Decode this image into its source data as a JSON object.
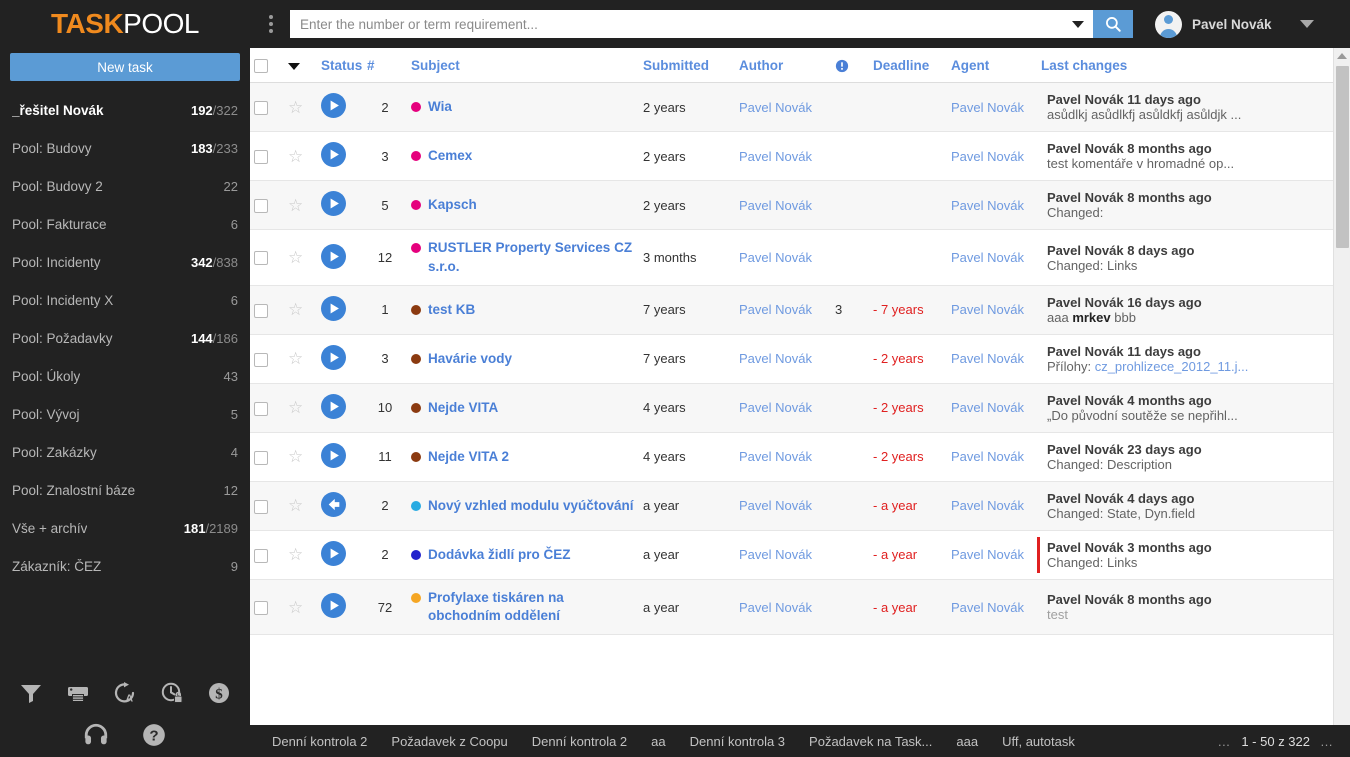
{
  "brand": {
    "part1": "TASK",
    "part2": "POOL"
  },
  "sidebar": {
    "new_task_label": "New task",
    "items": [
      {
        "label": "_řešitel Novák",
        "count_a": "192",
        "count_b": "322",
        "active": true
      },
      {
        "label": "Pool: Budovy",
        "count_a": "183",
        "count_b": "233",
        "active": false
      },
      {
        "label": "Pool: Budovy 2",
        "count_a": "",
        "count_b": "22",
        "active": false
      },
      {
        "label": "Pool: Fakturace",
        "count_a": "",
        "count_b": "6",
        "active": false
      },
      {
        "label": "Pool: Incidenty",
        "count_a": "342",
        "count_b": "838",
        "active": false
      },
      {
        "label": "Pool: Incidenty X",
        "count_a": "",
        "count_b": "6",
        "active": false
      },
      {
        "label": "Pool: Požadavky",
        "count_a": "144",
        "count_b": "186",
        "active": false
      },
      {
        "label": "Pool: Úkoly",
        "count_a": "",
        "count_b": "43",
        "active": false
      },
      {
        "label": "Pool: Vývoj",
        "count_a": "",
        "count_b": "5",
        "active": false
      },
      {
        "label": "Pool: Zakázky",
        "count_a": "",
        "count_b": "4",
        "active": false
      },
      {
        "label": "Pool: Znalostní báze",
        "count_a": "",
        "count_b": "12",
        "active": false
      },
      {
        "label": "Vše + archív",
        "count_a": "181",
        "count_b": "2189",
        "active": false
      },
      {
        "label": "Zákazník: ČEZ",
        "count_a": "",
        "count_b": "9",
        "active": false
      }
    ],
    "tools": [
      "filter-icon",
      "printer-icon",
      "redo-a-icon",
      "clock-lock-icon",
      "dollar-circle-icon"
    ],
    "tools2": [
      "headset-icon",
      "help-icon"
    ]
  },
  "topbar": {
    "menu_icon": "kebab-menu-icon",
    "search": {
      "value": "",
      "placeholder": "Enter the number or term requirement...",
      "dropdown_icon": "chevron-down-icon",
      "button_icon": "search-icon"
    },
    "user": {
      "name": "Pavel Novák",
      "avatar_icon": "avatar-icon",
      "caret_icon": "chevron-down-icon"
    }
  },
  "table": {
    "columns": [
      "",
      "",
      "Status",
      "#",
      "Subject",
      "Submitted",
      "Author",
      "!",
      "Deadline",
      "Agent",
      "Last changes"
    ],
    "header_priority_icon": "exclamation-circle-icon",
    "header_select_caret": "caret-down-icon",
    "rows": [
      {
        "status_icon": "play-circle-icon",
        "num": "2",
        "dot": "#e5007d",
        "subject": "Wia",
        "submitted": "2 years",
        "author": "Pavel Novák",
        "priority": "",
        "deadline": "",
        "agent": "Pavel Novák",
        "last_who": "Pavel Novák 11 days ago",
        "last_text": "asůdlkj asůdlkfj asůldkfj asůldjk ...",
        "flag": false
      },
      {
        "status_icon": "play-circle-icon",
        "num": "3",
        "dot": "#e5007d",
        "subject": "Cemex",
        "submitted": "2 years",
        "author": "Pavel Novák",
        "priority": "",
        "deadline": "",
        "agent": "Pavel Novák",
        "last_who": "Pavel Novák 8 months ago",
        "last_text": "test komentáře v hromadné op...",
        "flag": false
      },
      {
        "status_icon": "play-circle-icon",
        "num": "5",
        "dot": "#e5007d",
        "subject": "Kapsch",
        "submitted": "2 years",
        "author": "Pavel Novák",
        "priority": "",
        "deadline": "",
        "agent": "Pavel Novák",
        "last_who": "Pavel Novák 8 months ago",
        "last_text": "Changed:",
        "flag": false
      },
      {
        "status_icon": "play-circle-icon",
        "num": "12",
        "dot": "#e5007d",
        "subject": "RUSTLER Property Services CZ s.r.o.",
        "submitted": "3 months",
        "author": "Pavel Novák",
        "priority": "",
        "deadline": "",
        "agent": "Pavel Novák",
        "last_who": "Pavel Novák 8 days ago",
        "last_text": "Changed: Links",
        "flag": false
      },
      {
        "status_icon": "play-circle-icon",
        "num": "1",
        "dot": "#8b3a10",
        "subject": "test KB",
        "submitted": "7 years",
        "author": "Pavel Novák",
        "priority": "3",
        "deadline": "- 7 years",
        "agent": "Pavel Novák",
        "last_who": "Pavel Novák 16 days ago",
        "last_text": "aaa mrkev bbb",
        "last_bold": "mrkev",
        "flag": false
      },
      {
        "status_icon": "play-circle-icon",
        "num": "3",
        "dot": "#8b3a10",
        "subject": "Havárie vody",
        "submitted": "7 years",
        "author": "Pavel Novák",
        "priority": "",
        "deadline": "- 2 years",
        "agent": "Pavel Novák",
        "last_who": "Pavel Novák 11 days ago",
        "last_text": "Přílohy: cz_prohlizece_2012_11.j...",
        "last_attach": "cz_prohlizece_2012_11.j...",
        "flag": false
      },
      {
        "status_icon": "play-circle-icon",
        "num": "10",
        "dot": "#8b3a10",
        "subject": "Nejde VITA",
        "submitted": "4 years",
        "author": "Pavel Novák",
        "priority": "",
        "deadline": "- 2 years",
        "agent": "Pavel Novák",
        "last_who": "Pavel Novák 4 months ago",
        "last_text": "„Do původní soutěže se nepřihl...",
        "flag": false
      },
      {
        "status_icon": "play-circle-icon",
        "num": "11",
        "dot": "#8b3a10",
        "subject": "Nejde VITA 2",
        "submitted": "4 years",
        "author": "Pavel Novák",
        "priority": "",
        "deadline": "- 2 years",
        "agent": "Pavel Novák",
        "last_who": "Pavel Novák 23 days ago",
        "last_text": "Changed: Description",
        "flag": false
      },
      {
        "status_icon": "arrow-left-circle-icon",
        "num": "2",
        "dot": "#29abe2",
        "subject": "Nový vzhled modulu vyúčtování",
        "submitted": "a year",
        "author": "Pavel Novák",
        "priority": "",
        "deadline": "- a year",
        "agent": "Pavel Novák",
        "last_who": "Pavel Novák 4 days ago",
        "last_text": "Changed: State,  Dyn.field",
        "flag": false
      },
      {
        "status_icon": "play-circle-icon",
        "num": "2",
        "dot": "#2222cc",
        "subject": "Dodávka židlí pro ČEZ",
        "submitted": "a year",
        "author": "Pavel Novák",
        "priority": "",
        "deadline": "- a year",
        "agent": "Pavel Novák",
        "last_who": "Pavel Novák 3 months ago",
        "last_text": "Changed: Links",
        "flag": true
      },
      {
        "status_icon": "play-circle-icon",
        "num": "72",
        "dot": "#f5a623",
        "subject": "Profylaxe tiskáren na obchodním oddělení",
        "submitted": "a year",
        "author": "Pavel Novák",
        "priority": "",
        "deadline": "- a year",
        "agent": "Pavel Novák",
        "last_who": "Pavel Novák 8 months ago",
        "last_text": "test",
        "last_muted": true,
        "flag": false
      }
    ]
  },
  "bottombar": {
    "tabs": [
      "Denní kontrola 2",
      "Požadavek z Coopu",
      "Denní kontrola 2",
      "aa",
      "Denní kontrola 3",
      "Požadavek na Task...",
      "aaa",
      "Uff, autotask"
    ],
    "pager": {
      "prev": "…",
      "range": "1 - 50 z 322",
      "next": "…"
    }
  },
  "colors": {
    "brand_orange": "#f08a1e",
    "accent_blue": "#5b9bd5",
    "link_blue": "#4a7fd6",
    "danger_red": "#e02020",
    "sidebar_bg": "#222222"
  }
}
